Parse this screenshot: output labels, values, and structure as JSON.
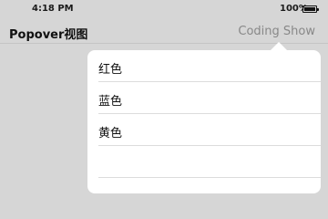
{
  "status_bar": {
    "time": "4:18 PM",
    "battery": "100%"
  },
  "nav": {
    "title": "Popover视图",
    "right_button": "Coding Show"
  },
  "popover": {
    "items": [
      {
        "label": "红色"
      },
      {
        "label": "蓝色"
      },
      {
        "label": "黄色"
      },
      {
        "label": ""
      },
      {
        "label": ""
      }
    ]
  },
  "colors": {
    "background": "#d6d6d6",
    "popover": "#ffffff",
    "nav_button": "#888888"
  }
}
